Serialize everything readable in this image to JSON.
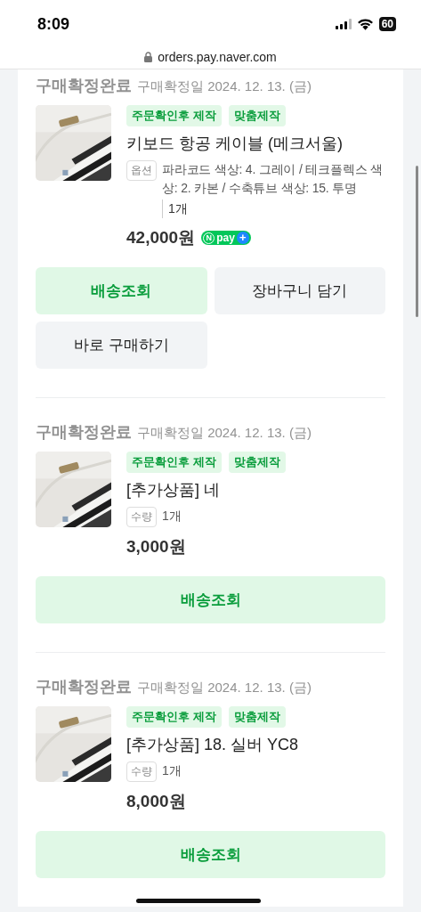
{
  "status_bar": {
    "time": "8:09",
    "battery": "60"
  },
  "url_bar": {
    "domain": "orders.pay.naver.com",
    "secure": true
  },
  "orders": [
    {
      "status": "구매확정완료",
      "date": "구매확정일 2024. 12. 13. (금)",
      "tags": [
        "주문확인후 제작",
        "맞춤제작"
      ],
      "name": "키보드 항공 케이블 (메크서울)",
      "detail": {
        "label": "옵션",
        "value": "파라코드 색상: 4. 그레이 / 테크플렉스 색상: 2. 카본 / 수축튜브 색상: 15. 투명",
        "quantity": "1개"
      },
      "price": "42,000원",
      "npay": {
        "mark": "N",
        "text": "pay",
        "plus": "+"
      },
      "buttons": [
        {
          "label": "배송조회",
          "kind": "primary"
        },
        {
          "label": "장바구니 담기",
          "kind": "secondary"
        },
        {
          "label": "바로 구매하기",
          "kind": "secondary"
        }
      ]
    },
    {
      "status": "구매확정완료",
      "date": "구매확정일 2024. 12. 13. (금)",
      "tags": [
        "주문확인후 제작",
        "맞춤제작"
      ],
      "name": "[추가상품] 네",
      "detail": {
        "label": "수량",
        "value": "1개"
      },
      "price": "3,000원",
      "buttons": [
        {
          "label": "배송조회",
          "kind": "primary"
        }
      ]
    },
    {
      "status": "구매확정완료",
      "date": "구매확정일 2024. 12. 13. (금)",
      "tags": [
        "주문확인후 제작",
        "맞춤제작"
      ],
      "name": "[추가상품] 18. 실버 YC8",
      "detail": {
        "label": "수량",
        "value": "1개"
      },
      "price": "8,000원",
      "buttons": [
        {
          "label": "배송조회",
          "kind": "primary"
        }
      ]
    }
  ]
}
